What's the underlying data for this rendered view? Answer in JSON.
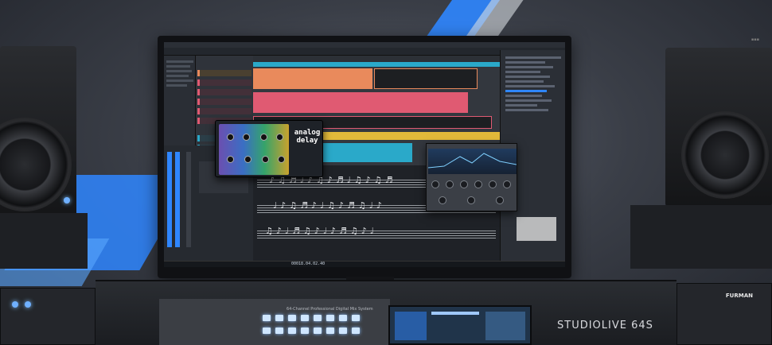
{
  "plugin": {
    "title_line1": "analog",
    "title_line2": "delay"
  },
  "transport": {
    "time": "00018.04.02.40"
  },
  "console": {
    "description": "64-Channel Professional Digital Mix System",
    "brand": "STUDIOLIVE 64S"
  },
  "rack": {
    "brand": "FURMAN"
  },
  "colors": {
    "accent_blue": "#2f86ff",
    "track_orange": "#e98a5c",
    "track_pink": "#e05a72",
    "track_cyan": "#2aa9c9",
    "track_yellow": "#e2b93a"
  }
}
